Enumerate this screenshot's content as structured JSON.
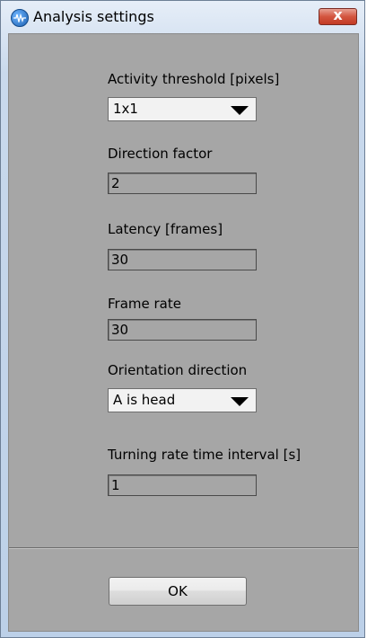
{
  "window": {
    "title": "Analysis settings",
    "close_label": "x",
    "app_icon": "waveform-app-icon"
  },
  "form": {
    "activity_threshold": {
      "label": "Activity threshold [pixels]",
      "value": "1x1"
    },
    "direction_factor": {
      "label": "Direction factor",
      "value": "2"
    },
    "latency": {
      "label": "Latency [frames]",
      "value": "30"
    },
    "frame_rate": {
      "label": "Frame rate",
      "value": "30"
    },
    "orientation_direction": {
      "label": "Orientation direction",
      "value": "A is head"
    },
    "turning_rate_interval": {
      "label": "Turning rate time interval [s]",
      "value": "1"
    }
  },
  "buttons": {
    "ok_label": "OK"
  },
  "colors": {
    "panel": "#a6a6a6",
    "close_red": "#c9432c",
    "frame": "#c9d9ec"
  }
}
